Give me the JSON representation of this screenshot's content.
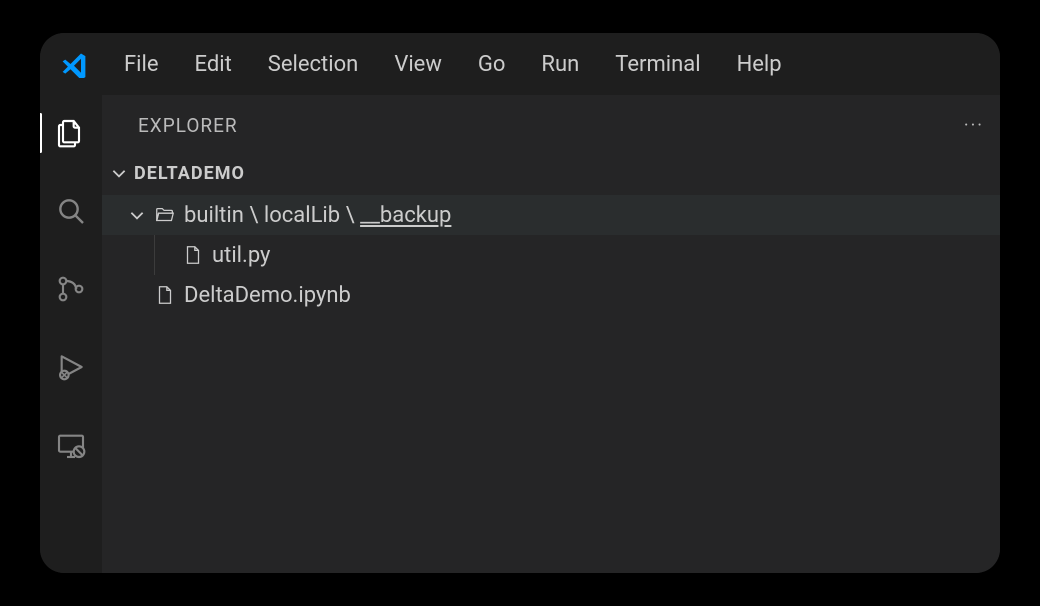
{
  "menubar": {
    "items": [
      "File",
      "Edit",
      "Selection",
      "View",
      "Go",
      "Run",
      "Terminal",
      "Help"
    ]
  },
  "sidebar": {
    "title": "EXPLORER",
    "actions_label": "···",
    "root_folder": "DELTADEMO",
    "tree": {
      "folder_path": {
        "segments": [
          "builtin",
          "localLib",
          "__backup"
        ],
        "separator": " \\ "
      },
      "children": [
        {
          "name": "util.py",
          "type": "file"
        }
      ],
      "root_files": [
        {
          "name": "DeltaDemo.ipynb",
          "type": "file"
        }
      ]
    }
  },
  "colors": {
    "accent": "#0098ff",
    "bg": "#1e1e1e",
    "sidebar_bg": "#252526",
    "text": "#cccccc",
    "muted": "#858585"
  }
}
